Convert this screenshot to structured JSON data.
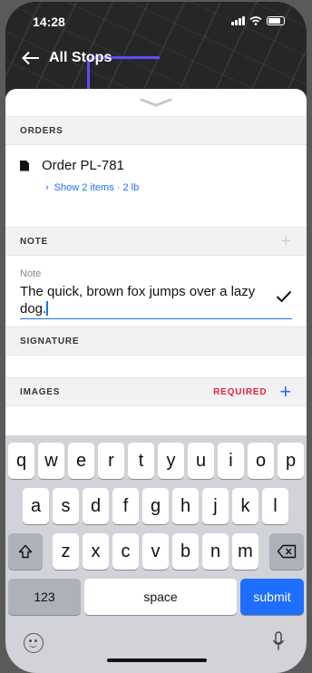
{
  "status": {
    "time": "14:28"
  },
  "header": {
    "title": "All Stops"
  },
  "orders": {
    "section_label": "ORDERS",
    "order_title": "Order PL-781",
    "items_link": "Show 2 items · 2 lb"
  },
  "note": {
    "section_label": "NOTE",
    "field_label": "Note",
    "value": "The quick, brown fox jumps over a lazy dog."
  },
  "signature": {
    "section_label": "SIGNATURE"
  },
  "images": {
    "section_label": "IMAGES",
    "required_label": "REQUIRED"
  },
  "keyboard": {
    "row1": [
      "q",
      "w",
      "e",
      "r",
      "t",
      "y",
      "u",
      "i",
      "o",
      "p"
    ],
    "row2": [
      "a",
      "s",
      "d",
      "f",
      "g",
      "h",
      "j",
      "k",
      "l"
    ],
    "row3": [
      "z",
      "x",
      "c",
      "v",
      "b",
      "n",
      "m"
    ],
    "numbers_label": "123",
    "space_label": "space",
    "submit_label": "submit"
  },
  "colors": {
    "accent": "#1e6fff",
    "required": "#e0243a",
    "keyboard_bg": "#d1d3d9"
  },
  "icons": [
    "back-arrow-icon",
    "document-icon",
    "chevron-right-icon",
    "plus-icon",
    "check-icon",
    "shift-icon",
    "backspace-icon",
    "emoji-icon",
    "microphone-icon"
  ]
}
